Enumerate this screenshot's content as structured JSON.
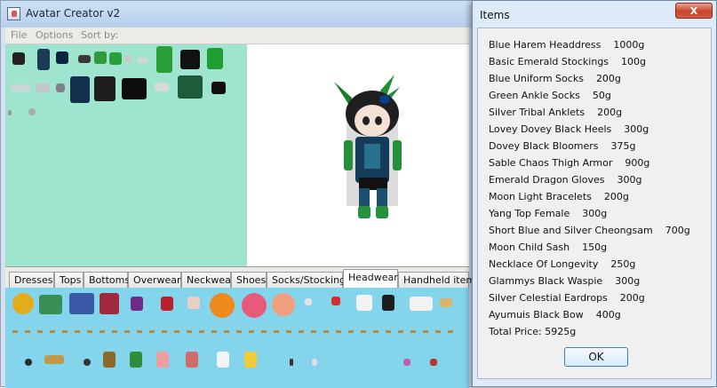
{
  "window": {
    "title": "Avatar Creator v2"
  },
  "menu": {
    "file": "File",
    "options": "Options",
    "sort_by": "Sort by:"
  },
  "tabs": [
    "Dresses",
    "Tops",
    "Bottoms",
    "Overwear",
    "Neckwear",
    "Shoes",
    "Socks/Stockings",
    "Headwear",
    "Handheld items"
  ],
  "active_tab": "Headwear",
  "dialog": {
    "title": "Items",
    "close_label": "X",
    "items": [
      {
        "name": "Blue Harem Headdress",
        "price": "1000g"
      },
      {
        "name": "Basic Emerald Stockings",
        "price": "100g"
      },
      {
        "name": "Blue Uniform Socks",
        "price": "200g"
      },
      {
        "name": "Green Ankle Socks",
        "price": "50g"
      },
      {
        "name": "Silver Tribal Anklets",
        "price": "200g"
      },
      {
        "name": "Lovey Dovey Black Heels",
        "price": "300g"
      },
      {
        "name": "Dovey Black Bloomers",
        "price": "375g"
      },
      {
        "name": "Sable Chaos Thigh Armor",
        "price": "900g"
      },
      {
        "name": "Emerald Dragon Gloves",
        "price": "300g"
      },
      {
        "name": "Moon Light Bracelets",
        "price": "200g"
      },
      {
        "name": "Yang Top Female",
        "price": "300g"
      },
      {
        "name": "Short Blue and Silver Cheongsam",
        "price": "700g"
      },
      {
        "name": "Moon Child Sash",
        "price": "150g"
      },
      {
        "name": "Necklace Of Longevity",
        "price": "250g"
      },
      {
        "name": "Glammys Black Waspie",
        "price": "300g"
      },
      {
        "name": "Silver Celestial Eardrops",
        "price": "200g"
      },
      {
        "name": "Ayumuis Black Bow",
        "price": "400g"
      }
    ],
    "total": "Total Price: 5925g",
    "ok_label": "OK"
  }
}
